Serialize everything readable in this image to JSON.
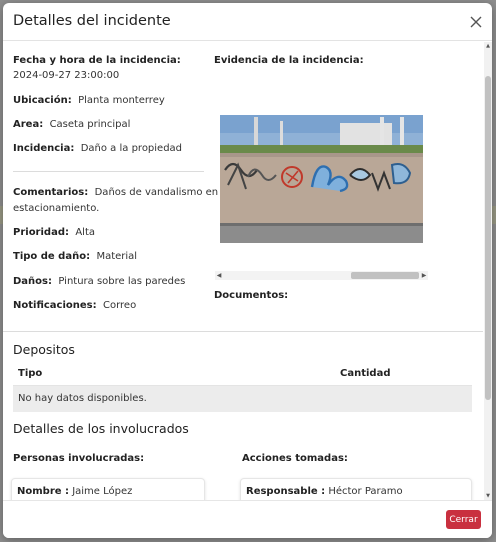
{
  "modal": {
    "title": "Detalles del incidente",
    "close_icon": "close-icon"
  },
  "incident": {
    "datetime_label": "Fecha y hora de la incidencia:",
    "datetime_value": "2024-09-27 23:00:00",
    "location_label": "Ubicación:",
    "location_value": "Planta monterrey",
    "area_label": "Area:",
    "area_value": "Caseta principal",
    "incident_label": "Incidencia:",
    "incident_value": "Daño a la propiedad",
    "comments_label": "Comentarios:",
    "comments_value_1": "Daños de vandalismo en el",
    "comments_value_2": "estacionamiento.",
    "priority_label": "Prioridad:",
    "priority_value": "Alta",
    "damage_type_label": "Tipo de daño:",
    "damage_type_value": "Material",
    "damages_label": "Daños:",
    "damages_value": "Pintura sobre las paredes",
    "notifications_label": "Notificaciones:",
    "notifications_value": "Correo"
  },
  "evidence": {
    "title": "Evidencia de la incidencia:",
    "documents_label": "Documentos:"
  },
  "deposits": {
    "title": "Depositos",
    "columns": [
      "Tipo",
      "Cantidad"
    ],
    "empty_text": "No hay datos disponibles."
  },
  "involved": {
    "title": "Detalles de los involucrados",
    "people_label": "Personas involucradas:",
    "actions_label": "Acciones tomadas:",
    "person_key": "Nombre :",
    "person_value": "Jaime López",
    "action_key": "Responsable :",
    "action_value": "Héctor Paramo"
  },
  "footer": {
    "close_button": "Cerrar"
  },
  "colors": {
    "danger": "#c9303f",
    "backdrop": "#8f8f8f"
  }
}
